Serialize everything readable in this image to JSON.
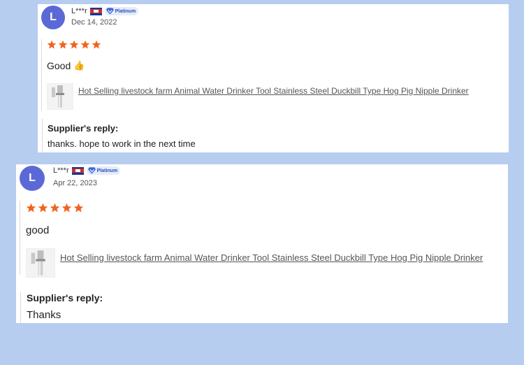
{
  "reviews": [
    {
      "avatar_letter": "L",
      "username": "L***r",
      "badge": "Platinum",
      "date": "Dec 14, 2022",
      "rating": 5,
      "text": "Good",
      "emoji": "👍",
      "product_title": "Hot Selling livestock farm Animal Water Drinker Tool Stainless Steel Duckbill Type Hog Pig Nipple Drinker",
      "reply_title": "Supplier's reply:",
      "reply_text": "thanks. hope to work in the next time"
    },
    {
      "avatar_letter": "L",
      "username": "L***r",
      "badge": "Platinum",
      "date": "Apr 22, 2023",
      "rating": 5,
      "text": "good",
      "product_title": "Hot Selling livestock farm Animal Water Drinker Tool Stainless Steel Duckbill Type Hog Pig Nipple Drinker",
      "reply_title": "Supplier's reply:",
      "reply_text": "Thanks"
    }
  ],
  "colors": {
    "background": "#b7cdf0",
    "avatar": "#5b69d6",
    "star": "#f0641e",
    "badge_bg": "#e4ecfb",
    "badge_text": "#2c4fb1"
  },
  "icons": {
    "flag": "cambodia-flag-icon",
    "badge": "platinum-diamond-icon",
    "star": "star-icon",
    "emoji": "thumbs-up-emoji"
  }
}
